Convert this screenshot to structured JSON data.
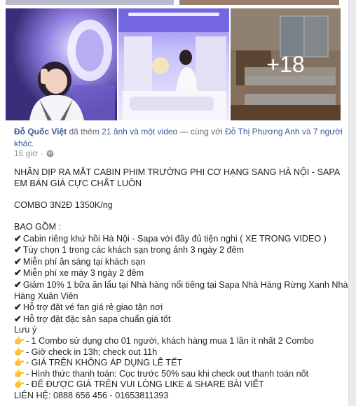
{
  "photos": {
    "more_count": "+18"
  },
  "header": {
    "author": "Đỗ Quốc Việt",
    "text_added": " đã thêm ",
    "media_link": "21 ảnh và một video",
    "text_with": " — cùng với ",
    "tagged": "Đỗ Thị Phương Anh",
    "text_and": " và ",
    "others": "7 người khác",
    "period": "."
  },
  "meta": {
    "time": "16 giờ",
    "dot": "·",
    "privacy_icon": "globe-icon"
  },
  "post": {
    "headline1": "NHÂN DỊP RA MẮT CABIN PHIM TRƯỜNG PHI CƠ HẠNG SANG HÀ NỘI - SAPA",
    "headline2": "EM BÁN GIÁ CỰC CHẤT LUÔN",
    "combo": "COMBO 3N2Đ 1350K/ng",
    "includes_title": "BAO GỒM :",
    "includes": [
      "Cabin riêng khứ hồi Hà Nội - Sapa với đầy đủ tiện nghi ( XE TRONG VIDEO )",
      "Tùy chọn 1 trong các khách sạn trong ảnh 3 ngày 2 đêm",
      "Miễn phí ăn sáng tại khách sạn",
      "Miễn phí xe máy 3 ngày 2 đêm",
      "Giảm 10% 1 bữa ăn lẩu tại Nhà hàng nổi tiếng tại Sapa Nhà Hàng Rừng Xanh Nhà",
      "Hỗ trợ đặt vé fan giá rẻ giao tận nơi",
      "Hỗ trợ đặt đặc sản sapa chuẩn giá tốt"
    ],
    "include_cont": "Hàng Xuân Viên",
    "note_title": "Lưu ý",
    "notes": [
      "- 1 Combo sử dụng cho 01 người, khách hàng mua 1 lần ít nhất 2 Combo",
      "- Giờ check in 13h; check out 11h",
      "- GIÁ TRÊN KHÔNG ÁP DỤNG LỄ TẾT",
      "- Hình thức thanh toán: Cọc trước 50% sau khi check out thanh toán nốt",
      "- ĐỂ ĐƯỢC GIÁ TRÊN VUI LÒNG LIKE & SHARE BÀI VIẾT"
    ],
    "contact": "LIÊN HỆ: 0888 656 456 - 01653811393"
  },
  "colors": {
    "link": "#385898",
    "text": "#1d2129",
    "meta": "#90949c"
  }
}
